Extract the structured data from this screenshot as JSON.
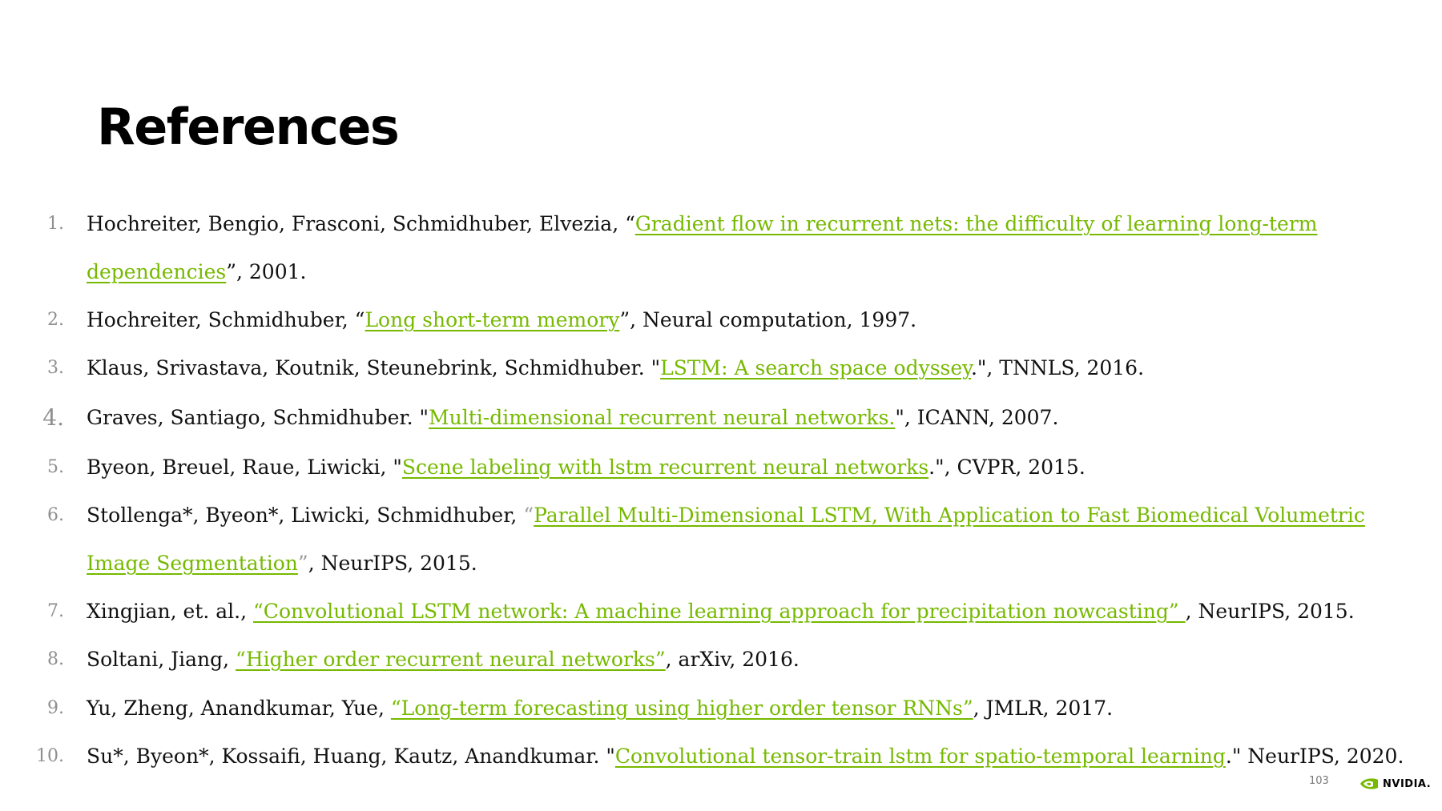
{
  "title": "References",
  "page_number": "103",
  "logo_text": "NVIDIA.",
  "colors": {
    "link": "#76b900",
    "number": "#8f8f8f"
  },
  "refs": [
    {
      "num": "1.",
      "pre": "Hochreiter, Bengio, Frasconi, Schmidhuber, Elvezia, “",
      "link1": "Gradient flow in recurrent nets: the difficulty of learning long-term",
      "link2": "dependencies",
      "post": "”, 2001."
    },
    {
      "num": "2.",
      "pre": "Hochreiter, Schmidhuber, “",
      "link": "Long short-term memory",
      "post": "”, Neural computation, 1997."
    },
    {
      "num": "3.",
      "pre": "Klaus, Srivastava, Koutnik, Steunebrink,  Schmidhuber. \"",
      "link": "LSTM: A search space odyssey",
      "post": ".\", TNNLS, 2016."
    },
    {
      "num": "4.",
      "pre": "Graves, Santiago, Schmidhuber. \"",
      "link": "Multi-dimensional recurrent neural networks.",
      "post": "\", ICANN, 2007."
    },
    {
      "num": "5.",
      "pre": "Byeon, Breuel, Raue, Liwicki, \"",
      "link": "Scene labeling with lstm recurrent neural networks",
      "post": ".\", CVPR, 2015."
    },
    {
      "num": "6.",
      "pre": "Stollenga*, Byeon*, Liwicki, Schmidhuber, ",
      "open_quote": "“",
      "link1": "Parallel Multi-Dimensional LSTM, With Application to Fast Biomedical Volumetric",
      "link2": "Image Segmentation",
      "close_quote": "”",
      "post": ", NeurIPS, 2015."
    },
    {
      "num": "7.",
      "pre": "Xingjian, et. al., ",
      "link": "“Convolutional LSTM network: A machine learning approach for precipitation nowcasting” ",
      "post": ", NeurIPS, 2015."
    },
    {
      "num": "8.",
      "pre": "Soltani, Jiang, ",
      "link": "“Higher order recurrent neural networks”",
      "post": ", arXiv, 2016."
    },
    {
      "num": "9.",
      "pre": "Yu, Zheng, Anandkumar, Yue, ",
      "link": "“Long-term forecasting using higher order tensor RNNs”",
      "post": ", JMLR, 2017."
    },
    {
      "num": "10.",
      "pre": "Su*, Byeon*, Kossaifi, Huang, Kautz, Anandkumar. \"",
      "link": "Convolutional tensor-train lstm for spatio-temporal learning",
      "post": ".\" NeurIPS, 2020."
    }
  ]
}
